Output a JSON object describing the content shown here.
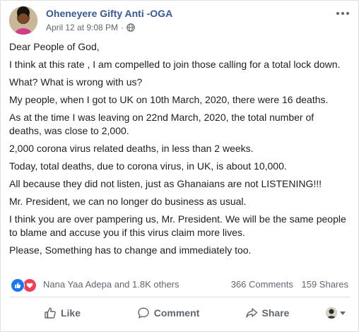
{
  "post": {
    "author": "Oheneyere Gifty Anti -OGA",
    "timestamp": "April 12 at 9:08 PM",
    "separator": "·",
    "privacy_icon": "globe-icon",
    "paragraphs": [
      "Dear People of God,",
      "I think at this rate , I am compelled to join those calling for a total lock down.",
      "What? What is wrong with us?",
      "My people, when I got to UK on 10th March, 2020, there were 16 deaths.",
      "As at the time I was leaving on 22nd March, 2020, the total number of deaths, was close to 2,000.",
      "2,000 corona virus related deaths, in less than 2 weeks.",
      "Today, total deaths, due to corona virus, in UK, is about 10,000.",
      "All because they did not listen, just as Ghanaians are not LISTENING!!!",
      "Mr. President, we can no longer do business as usual.",
      "I think you are over pampering us, Mr. President. We will be the same people to blame and accuse you if this virus claim more lives.",
      "Please, Something has to change and immediately too."
    ]
  },
  "reactions": {
    "icons": [
      "like-icon",
      "love-icon"
    ],
    "summary": "Nana Yaa Adepa and 1.8K others",
    "comments": "366 Comments",
    "shares": "159 Shares"
  },
  "actions": {
    "like": "Like",
    "comment": "Comment",
    "share": "Share"
  },
  "colors": {
    "author": "#385898",
    "text": "#1c1e21",
    "muted": "#606770",
    "like_blue": "#1877f2",
    "love_red": "#f33e58"
  }
}
